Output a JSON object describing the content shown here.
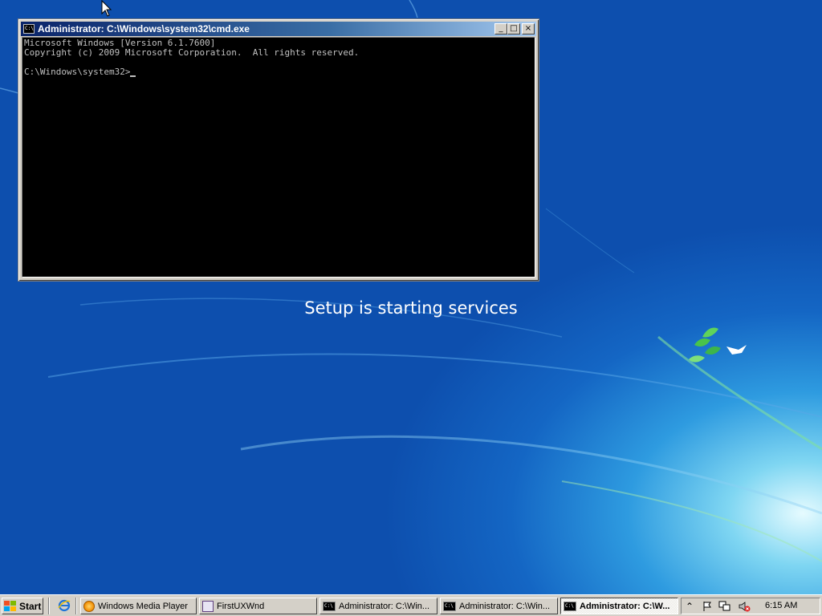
{
  "window": {
    "title": "Administrator: C:\\Windows\\system32\\cmd.exe",
    "icon_text": "C:\\",
    "controls": {
      "minimize": "_",
      "maximize": "□",
      "close": "×"
    },
    "console_lines": [
      "Microsoft Windows [Version 6.1.7600]",
      "Copyright (c) 2009 Microsoft Corporation.  All rights reserved.",
      "",
      "C:\\Windows\\system32>"
    ]
  },
  "desktop": {
    "status_text": "Setup is starting services"
  },
  "taskbar": {
    "start_label": "Start",
    "quick_launch": [
      "ie-icon"
    ],
    "buttons": [
      {
        "label": "Windows Media Player",
        "icon": "media-player-icon",
        "active": false
      },
      {
        "label": "FirstUXWnd",
        "icon": "firstux-icon",
        "active": false
      },
      {
        "label": "Administrator: C:\\Win...",
        "icon": "cmd-icon",
        "active": false
      },
      {
        "label": "Administrator: C:\\Win...",
        "icon": "cmd-icon",
        "active": false
      },
      {
        "label": "Administrator: C:\\W...",
        "icon": "cmd-icon",
        "active": true
      }
    ],
    "tray": {
      "icons": [
        "show-hidden-icons",
        "action-center-flag-icon",
        "network-icon",
        "volume-muted-icon"
      ],
      "clock": "6:15 AM"
    }
  },
  "colors": {
    "desktop_blue": "#1466c4",
    "titlebar_start": "#0a246a",
    "titlebar_end": "#a6caf0",
    "console_bg": "#000000",
    "console_text": "#c0c0c0",
    "taskbar_gray": "#d4d0c8"
  }
}
